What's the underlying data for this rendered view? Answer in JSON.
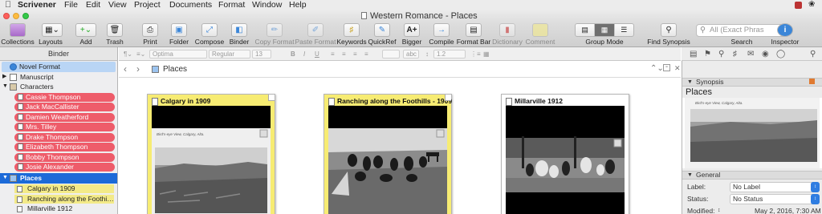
{
  "menubar": {
    "app": "Scrivener",
    "items": [
      "File",
      "Edit",
      "View",
      "Project",
      "Documents",
      "Format",
      "Window",
      "Help"
    ]
  },
  "window": {
    "title": "Western Romance - Places"
  },
  "toolbar": {
    "collections": "Collections",
    "layouts": "Layouts",
    "add": "Add",
    "trash": "Trash",
    "print": "Print",
    "folder": "Folder",
    "compose": "Compose",
    "binder": "Binder",
    "copy_format": "Copy Format",
    "paste_format": "Paste Format",
    "keywords": "Keywords",
    "quickref": "QuickRef",
    "bigger": "Bigger",
    "compile": "Compile",
    "format_bar": "Format Bar",
    "dictionary": "Dictionary",
    "comment": "Comment",
    "group_mode": "Group Mode",
    "find_synopsis": "Find Synopsis",
    "search_label": "Search",
    "search_placeholder": "All (Exact Phras",
    "inspector": "Inspector",
    "bigger_icon_text": "A+"
  },
  "binder": {
    "header": "Binder",
    "items": {
      "novel_format": "Novel Format",
      "manuscript": "Manuscript",
      "characters": "Characters",
      "char0": "Cassie Thompson",
      "char1": "Jack MacCallister",
      "char2": "Damien Weatherford",
      "char3": "Mrs. Tilley",
      "char4": "Drake Thompson",
      "char5": "Elizabeth Thompson",
      "char6": "Bobby Thompson",
      "char7": "Josie Alexander",
      "places": "Places",
      "place0": "Calgary in 1909",
      "place1": "Ranching along the Foothills - 1909",
      "place2": "Millarville 1912"
    },
    "label_color": "#ee5c6a",
    "status_color": "#f3ea88",
    "selection_color": "#1c6ad8"
  },
  "format_bar": {
    "font": "Optima",
    "style": "Regular",
    "size": "13",
    "spacing": "1.2",
    "text_color_label": "abc"
  },
  "editor": {
    "path_title": "Places",
    "cards": [
      {
        "title": "Calgary in 1909",
        "caption": "Bird's-eye View, Calgary, Alta."
      },
      {
        "title": "Ranching along the Foothills - 1909"
      },
      {
        "title": "Millarville 1912"
      }
    ]
  },
  "inspector": {
    "synopsis_header": "Synopsis",
    "synopsis_title": "Places",
    "synopsis_caption": "Bird's-eye View, Calgary, Alta.",
    "general_header": "General",
    "label_label": "Label:",
    "label_value": "No Label",
    "status_label": "Status:",
    "status_value": "No Status",
    "modified_label": "Modified:",
    "modified_value": "May 2, 2016, 7:30 AM"
  }
}
